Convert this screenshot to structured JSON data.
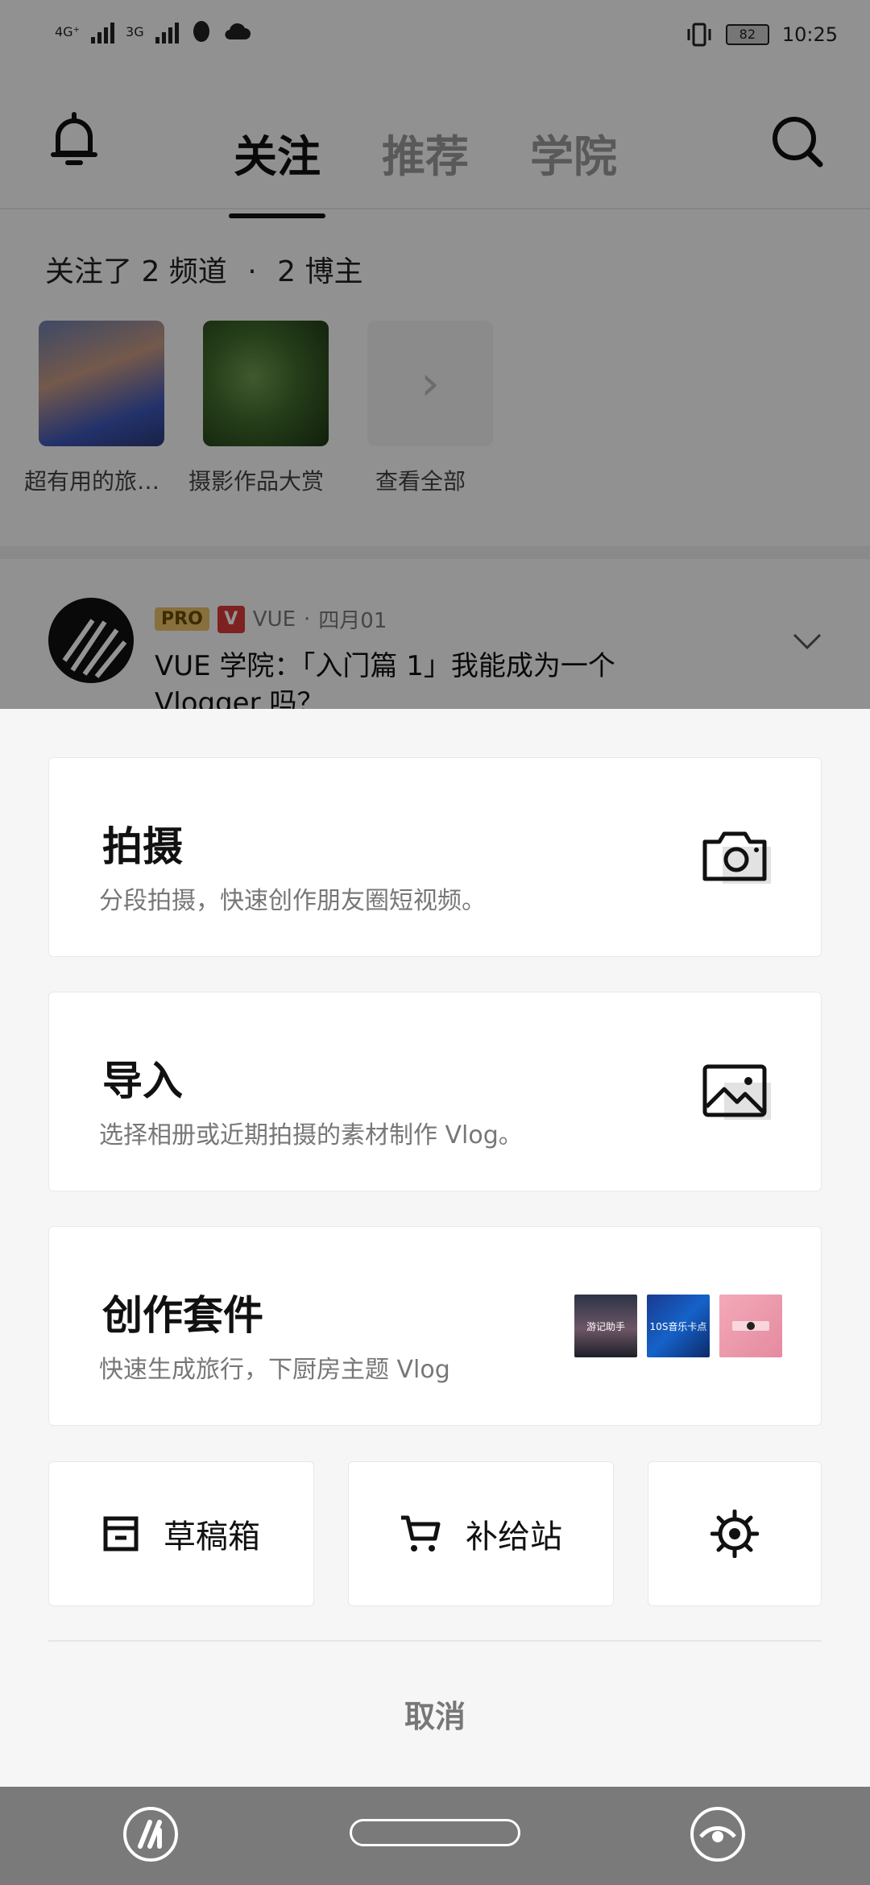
{
  "status_bar": {
    "network_1": "4G⁺",
    "network_2": "3G",
    "battery": "82",
    "time": "10:25"
  },
  "top_nav": {
    "tabs": [
      {
        "label": "关注",
        "active": true
      },
      {
        "label": "推荐",
        "active": false
      },
      {
        "label": "学院",
        "active": false
      }
    ]
  },
  "follow_summary": {
    "channels_text": "关注了 2 频道",
    "dot": "·",
    "bloggers_text": "2 博主"
  },
  "channels": [
    {
      "name": "超有用的旅…"
    },
    {
      "name": "摄影作品大赏"
    },
    {
      "name": "查看全部"
    }
  ],
  "post": {
    "pro_badge": "PRO",
    "v_badge": "V",
    "author": "VUE",
    "dot": "·",
    "date": "四月01",
    "title": "VUE 学院：「入门篇 1」我能成为一个 Vlogger 吗？"
  },
  "sheet": {
    "shoot": {
      "title": "拍摄",
      "subtitle": "分段拍摄，快速创作朋友圈短视频。"
    },
    "import": {
      "title": "导入",
      "subtitle": "选择相册或近期拍摄的素材制作 Vlog。"
    },
    "kit": {
      "title": "创作套件",
      "subtitle": "快速生成旅行，下厨房主题 Vlog",
      "items": [
        "游记助手",
        "10S音乐卡点",
        ""
      ]
    },
    "drafts_label": "草稿箱",
    "supply_label": "补给站",
    "cancel_label": "取消"
  },
  "colors": {
    "scrim": "rgba(0,0,0,0.42)",
    "sheet_bg": "#f6f6f6",
    "nav_bar": "#7a7a7a"
  }
}
